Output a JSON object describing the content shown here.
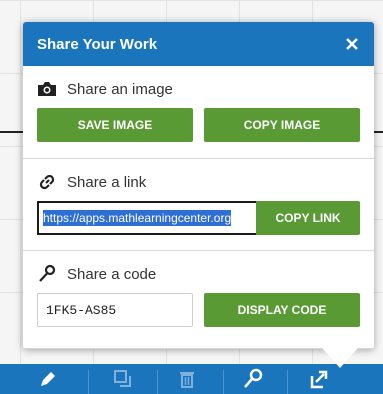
{
  "dialog": {
    "title": "Share Your Work"
  },
  "share_image": {
    "heading": "Share an image",
    "save_label": "SAVE IMAGE",
    "copy_label": "COPY IMAGE"
  },
  "share_link": {
    "heading": "Share a link",
    "url": "https://apps.mathlearningcenter.org",
    "copy_label": "COPY LINK"
  },
  "share_code": {
    "heading": "Share a code",
    "code": "1FK5-AS85",
    "display_label": "DISPLAY CODE"
  },
  "toolbar": {
    "tools": [
      "pencil-icon",
      "duplicate-icon",
      "trash-icon",
      "key-icon",
      "share-icon"
    ]
  },
  "colors": {
    "header_blue": "#1a75bc",
    "button_green": "#5a9a35",
    "selection_blue": "#2f6fd4"
  }
}
